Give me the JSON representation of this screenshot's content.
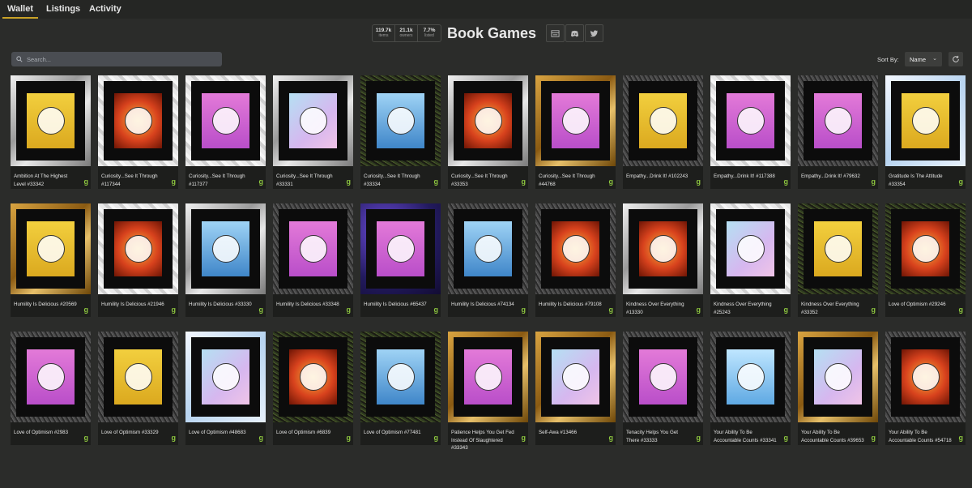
{
  "nav": {
    "tabs": [
      {
        "label": "Wallet"
      },
      {
        "label": "Listings"
      },
      {
        "label": "Activity"
      }
    ]
  },
  "header": {
    "title": "Book Games",
    "stats": [
      {
        "value": "119.7k",
        "label": "items"
      },
      {
        "value": "21.1k",
        "label": "owners"
      },
      {
        "value": "7.7%",
        "label": "listed"
      }
    ],
    "icons": [
      "website-icon",
      "discord-icon",
      "twitter-icon"
    ]
  },
  "search": {
    "placeholder": "Search..."
  },
  "sort": {
    "label": "Sort By:",
    "value": "Name"
  },
  "colors": {
    "accent": "#c9a227",
    "logo": "#8dc63f",
    "background": "#2b2c2a"
  },
  "cards": [
    {
      "name": "Ambition At The Highest Level #33342",
      "frame": "silver",
      "art": "yellow"
    },
    {
      "name": "Curiosity...See It Through #117344",
      "frame": "marble",
      "art": "fire"
    },
    {
      "name": "Curiosity...See It Through #117377",
      "frame": "marble",
      "art": "pink"
    },
    {
      "name": "Curiosity...See It Through #33331",
      "frame": "silver",
      "art": "pastel"
    },
    {
      "name": "Curiosity...See It Through #33334",
      "frame": "glitter",
      "art": "blue"
    },
    {
      "name": "Curiosity...See It Through #33353",
      "frame": "silver",
      "art": "fire"
    },
    {
      "name": "Curiosity...See It Through #44768",
      "frame": "gold",
      "art": "pink"
    },
    {
      "name": "Empathy...Drink It! #102243",
      "frame": "granite",
      "art": "yellow"
    },
    {
      "name": "Empathy...Drink It! #117388",
      "frame": "marble",
      "art": "pink"
    },
    {
      "name": "Empathy...Drink It! #79632",
      "frame": "granite",
      "art": "pink"
    },
    {
      "name": "Gratitude Is The Attitude #33354",
      "frame": "ice",
      "art": "yellow"
    },
    {
      "name": "Humility Is Delicious #20569",
      "frame": "gold",
      "art": "yellow"
    },
    {
      "name": "Humility Is Delicious #21946",
      "frame": "marble",
      "art": "fire"
    },
    {
      "name": "Humility Is Delicious #33330",
      "frame": "silver",
      "art": "blue"
    },
    {
      "name": "Humility Is Delicious #33348",
      "frame": "granite",
      "art": "pink"
    },
    {
      "name": "Humility Is Delicious #65437",
      "frame": "space",
      "art": "pink"
    },
    {
      "name": "Humility Is Delicious #74134",
      "frame": "granite",
      "art": "blue"
    },
    {
      "name": "Humility Is Delicious #79108",
      "frame": "granite",
      "art": "fire"
    },
    {
      "name": "Kindness Over Everything #13330",
      "frame": "silver",
      "art": "fire"
    },
    {
      "name": "Kindness Over Everything #25243",
      "frame": "marble",
      "art": "pastel"
    },
    {
      "name": "Kindness Over Everything #33352",
      "frame": "glitter",
      "art": "yellow"
    },
    {
      "name": "Love of Optimism #29246",
      "frame": "glitter",
      "art": "fire"
    },
    {
      "name": "Love of Optimism #2983",
      "frame": "granite",
      "art": "pink"
    },
    {
      "name": "Love of Optimism #33329",
      "frame": "granite",
      "art": "yellow"
    },
    {
      "name": "Love of Optimism #48683",
      "frame": "ice",
      "art": "pastel"
    },
    {
      "name": "Love of Optimism #6839",
      "frame": "glitter",
      "art": "fire"
    },
    {
      "name": "Love of Optimism #77481",
      "frame": "glitter",
      "art": "blue"
    },
    {
      "name": "Patience Helps You Get Fed Instead Of Slaughtered #33343",
      "frame": "gold",
      "art": "pink"
    },
    {
      "name": "Self-Awa #13466",
      "frame": "gold",
      "art": "pastel"
    },
    {
      "name": "Tenacity Helps You Get There #33333",
      "frame": "granite",
      "art": "pink"
    },
    {
      "name": "Your Ability To Be Accountable Counts #33341",
      "frame": "granite",
      "art": "skyblue"
    },
    {
      "name": "Your Ability To Be Accountable Counts #39653",
      "frame": "gold",
      "art": "pastel"
    },
    {
      "name": "Your Ability To Be Accountable Counts #54718",
      "frame": "granite",
      "art": "fire"
    }
  ],
  "logo_text": "g"
}
